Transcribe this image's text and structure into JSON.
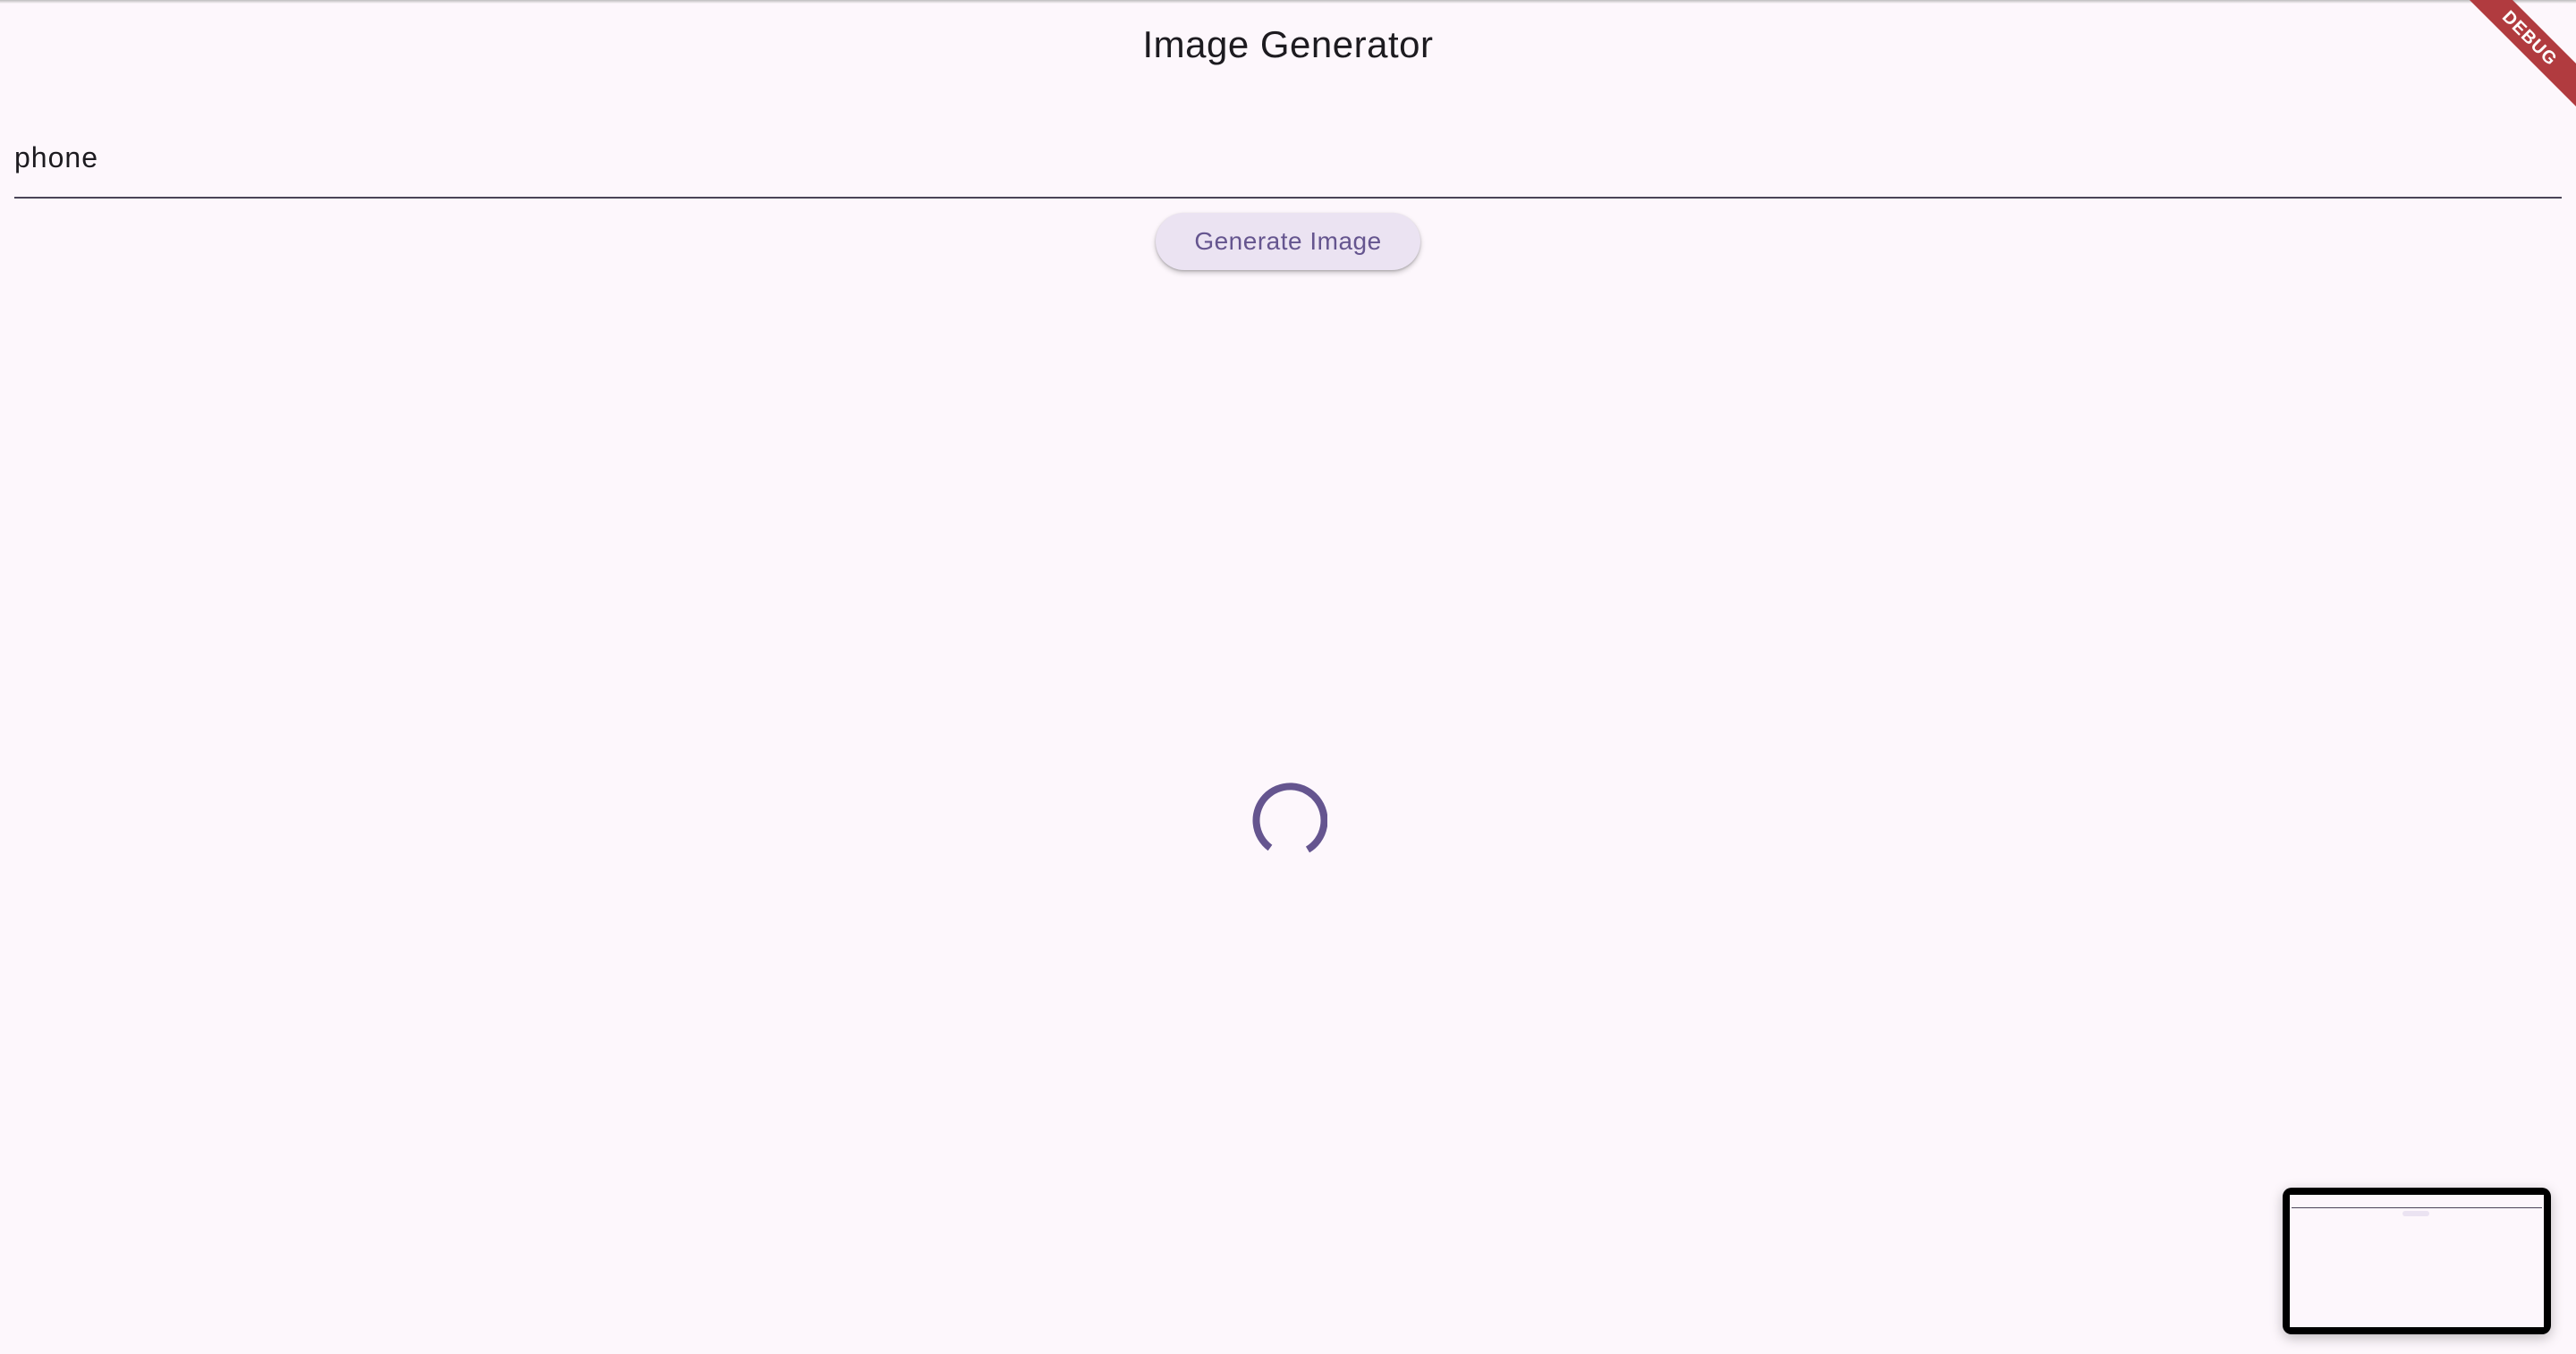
{
  "app": {
    "title": "Image Generator"
  },
  "prompt_field": {
    "value": "phone"
  },
  "generate_button": {
    "label": "Generate Image"
  },
  "debug_banner": {
    "label": "DEBUG"
  },
  "colors": {
    "background": "#fdf7fc",
    "primary": "#65558f",
    "button_bg": "#ebe3f2",
    "debug_ribbon": "#b13b3f"
  },
  "icons": {
    "loading": "progress-spinner-icon"
  }
}
